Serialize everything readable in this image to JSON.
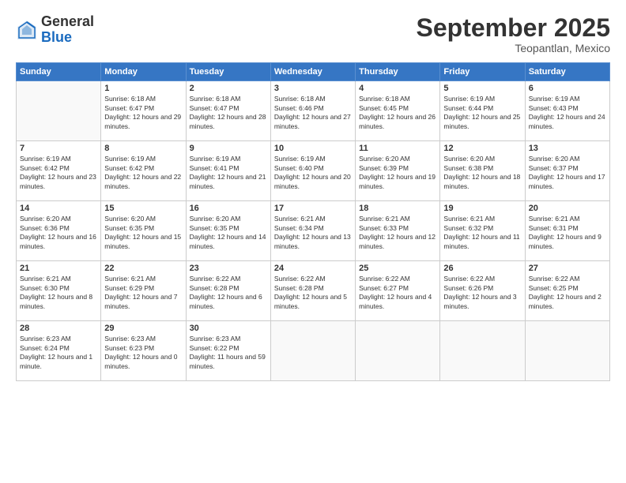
{
  "logo": {
    "general": "General",
    "blue": "Blue"
  },
  "header": {
    "month": "September 2025",
    "location": "Teopantlan, Mexico"
  },
  "days_of_week": [
    "Sunday",
    "Monday",
    "Tuesday",
    "Wednesday",
    "Thursday",
    "Friday",
    "Saturday"
  ],
  "weeks": [
    [
      {
        "day": "",
        "sunrise": "",
        "sunset": "",
        "daylight": ""
      },
      {
        "day": "1",
        "sunrise": "Sunrise: 6:18 AM",
        "sunset": "Sunset: 6:47 PM",
        "daylight": "Daylight: 12 hours and 29 minutes."
      },
      {
        "day": "2",
        "sunrise": "Sunrise: 6:18 AM",
        "sunset": "Sunset: 6:47 PM",
        "daylight": "Daylight: 12 hours and 28 minutes."
      },
      {
        "day": "3",
        "sunrise": "Sunrise: 6:18 AM",
        "sunset": "Sunset: 6:46 PM",
        "daylight": "Daylight: 12 hours and 27 minutes."
      },
      {
        "day": "4",
        "sunrise": "Sunrise: 6:18 AM",
        "sunset": "Sunset: 6:45 PM",
        "daylight": "Daylight: 12 hours and 26 minutes."
      },
      {
        "day": "5",
        "sunrise": "Sunrise: 6:19 AM",
        "sunset": "Sunset: 6:44 PM",
        "daylight": "Daylight: 12 hours and 25 minutes."
      },
      {
        "day": "6",
        "sunrise": "Sunrise: 6:19 AM",
        "sunset": "Sunset: 6:43 PM",
        "daylight": "Daylight: 12 hours and 24 minutes."
      }
    ],
    [
      {
        "day": "7",
        "sunrise": "Sunrise: 6:19 AM",
        "sunset": "Sunset: 6:42 PM",
        "daylight": "Daylight: 12 hours and 23 minutes."
      },
      {
        "day": "8",
        "sunrise": "Sunrise: 6:19 AM",
        "sunset": "Sunset: 6:42 PM",
        "daylight": "Daylight: 12 hours and 22 minutes."
      },
      {
        "day": "9",
        "sunrise": "Sunrise: 6:19 AM",
        "sunset": "Sunset: 6:41 PM",
        "daylight": "Daylight: 12 hours and 21 minutes."
      },
      {
        "day": "10",
        "sunrise": "Sunrise: 6:19 AM",
        "sunset": "Sunset: 6:40 PM",
        "daylight": "Daylight: 12 hours and 20 minutes."
      },
      {
        "day": "11",
        "sunrise": "Sunrise: 6:20 AM",
        "sunset": "Sunset: 6:39 PM",
        "daylight": "Daylight: 12 hours and 19 minutes."
      },
      {
        "day": "12",
        "sunrise": "Sunrise: 6:20 AM",
        "sunset": "Sunset: 6:38 PM",
        "daylight": "Daylight: 12 hours and 18 minutes."
      },
      {
        "day": "13",
        "sunrise": "Sunrise: 6:20 AM",
        "sunset": "Sunset: 6:37 PM",
        "daylight": "Daylight: 12 hours and 17 minutes."
      }
    ],
    [
      {
        "day": "14",
        "sunrise": "Sunrise: 6:20 AM",
        "sunset": "Sunset: 6:36 PM",
        "daylight": "Daylight: 12 hours and 16 minutes."
      },
      {
        "day": "15",
        "sunrise": "Sunrise: 6:20 AM",
        "sunset": "Sunset: 6:35 PM",
        "daylight": "Daylight: 12 hours and 15 minutes."
      },
      {
        "day": "16",
        "sunrise": "Sunrise: 6:20 AM",
        "sunset": "Sunset: 6:35 PM",
        "daylight": "Daylight: 12 hours and 14 minutes."
      },
      {
        "day": "17",
        "sunrise": "Sunrise: 6:21 AM",
        "sunset": "Sunset: 6:34 PM",
        "daylight": "Daylight: 12 hours and 13 minutes."
      },
      {
        "day": "18",
        "sunrise": "Sunrise: 6:21 AM",
        "sunset": "Sunset: 6:33 PM",
        "daylight": "Daylight: 12 hours and 12 minutes."
      },
      {
        "day": "19",
        "sunrise": "Sunrise: 6:21 AM",
        "sunset": "Sunset: 6:32 PM",
        "daylight": "Daylight: 12 hours and 11 minutes."
      },
      {
        "day": "20",
        "sunrise": "Sunrise: 6:21 AM",
        "sunset": "Sunset: 6:31 PM",
        "daylight": "Daylight: 12 hours and 9 minutes."
      }
    ],
    [
      {
        "day": "21",
        "sunrise": "Sunrise: 6:21 AM",
        "sunset": "Sunset: 6:30 PM",
        "daylight": "Daylight: 12 hours and 8 minutes."
      },
      {
        "day": "22",
        "sunrise": "Sunrise: 6:21 AM",
        "sunset": "Sunset: 6:29 PM",
        "daylight": "Daylight: 12 hours and 7 minutes."
      },
      {
        "day": "23",
        "sunrise": "Sunrise: 6:22 AM",
        "sunset": "Sunset: 6:28 PM",
        "daylight": "Daylight: 12 hours and 6 minutes."
      },
      {
        "day": "24",
        "sunrise": "Sunrise: 6:22 AM",
        "sunset": "Sunset: 6:28 PM",
        "daylight": "Daylight: 12 hours and 5 minutes."
      },
      {
        "day": "25",
        "sunrise": "Sunrise: 6:22 AM",
        "sunset": "Sunset: 6:27 PM",
        "daylight": "Daylight: 12 hours and 4 minutes."
      },
      {
        "day": "26",
        "sunrise": "Sunrise: 6:22 AM",
        "sunset": "Sunset: 6:26 PM",
        "daylight": "Daylight: 12 hours and 3 minutes."
      },
      {
        "day": "27",
        "sunrise": "Sunrise: 6:22 AM",
        "sunset": "Sunset: 6:25 PM",
        "daylight": "Daylight: 12 hours and 2 minutes."
      }
    ],
    [
      {
        "day": "28",
        "sunrise": "Sunrise: 6:23 AM",
        "sunset": "Sunset: 6:24 PM",
        "daylight": "Daylight: 12 hours and 1 minute."
      },
      {
        "day": "29",
        "sunrise": "Sunrise: 6:23 AM",
        "sunset": "Sunset: 6:23 PM",
        "daylight": "Daylight: 12 hours and 0 minutes."
      },
      {
        "day": "30",
        "sunrise": "Sunrise: 6:23 AM",
        "sunset": "Sunset: 6:22 PM",
        "daylight": "Daylight: 11 hours and 59 minutes."
      },
      {
        "day": "",
        "sunrise": "",
        "sunset": "",
        "daylight": ""
      },
      {
        "day": "",
        "sunrise": "",
        "sunset": "",
        "daylight": ""
      },
      {
        "day": "",
        "sunrise": "",
        "sunset": "",
        "daylight": ""
      },
      {
        "day": "",
        "sunrise": "",
        "sunset": "",
        "daylight": ""
      }
    ]
  ]
}
